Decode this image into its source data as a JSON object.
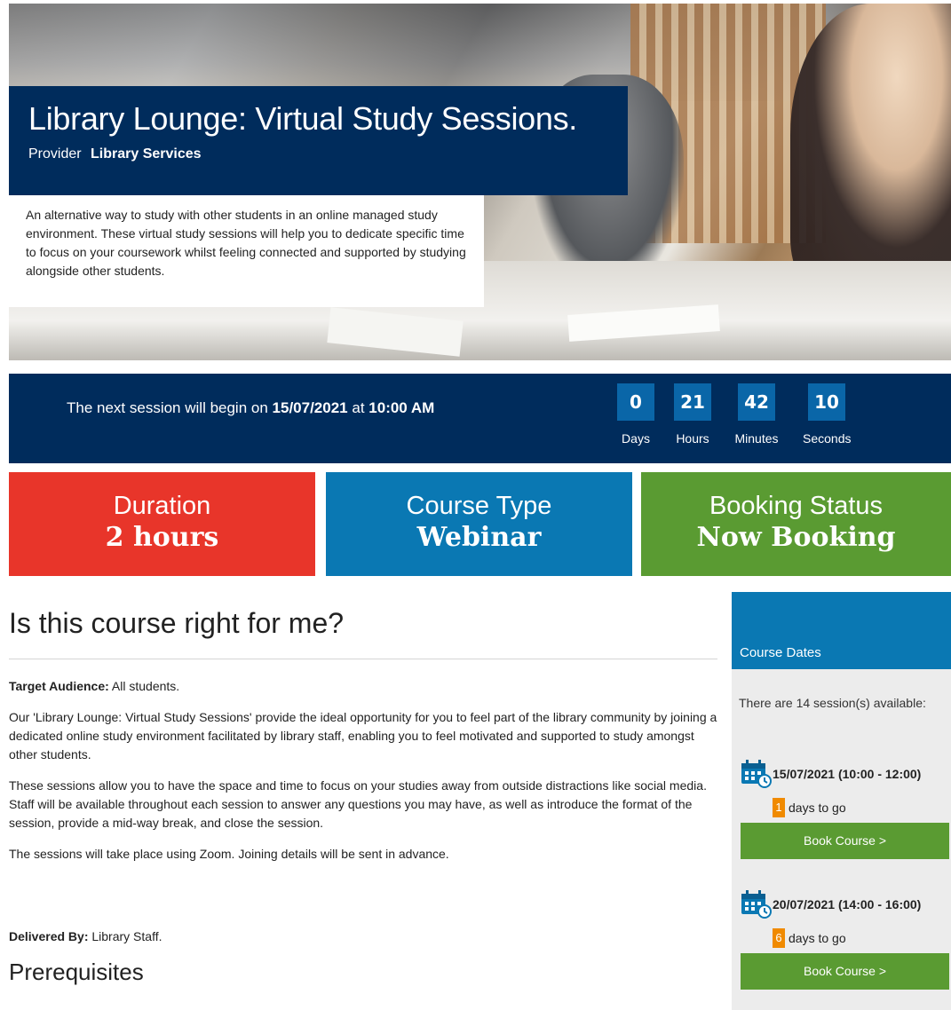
{
  "hero": {
    "title": "Library Lounge: Virtual Study Sessions.",
    "provider_label": "Provider",
    "provider_name": "Library Services",
    "description": "An alternative way to study with other students in an online managed study environment. These virtual study sessions will help you to dedicate specific time to focus on your coursework whilst feeling connected and supported by studying alongside other students."
  },
  "countdown": {
    "prefix": "The next session will begin on",
    "date": "15/07/2021",
    "at": "at",
    "time": "10:00 AM",
    "units": [
      {
        "value": "0",
        "label": "Days"
      },
      {
        "value": "21",
        "label": "Hours"
      },
      {
        "value": "42",
        "label": "Minutes"
      },
      {
        "value": "10",
        "label": "Seconds"
      }
    ]
  },
  "stats": {
    "duration": {
      "label": "Duration",
      "value": "2 hours",
      "color": "#e8352a"
    },
    "course_type": {
      "label": "Course Type",
      "value": "Webinar",
      "color": "#0a78b3"
    },
    "booking_status": {
      "label": "Booking Status",
      "value": "Now Booking",
      "color": "#5a9b32"
    }
  },
  "main": {
    "heading": "Is this course right for me?",
    "target_label": "Target Audience:",
    "target_value": "All students.",
    "para1": "Our 'Library Lounge: Virtual Study Sessions' provide the ideal opportunity for you to feel part of the library community by joining a dedicated online study environment facilitated by library staff, enabling you to feel motivated and supported to study amongst other students.",
    "para2": "These sessions allow you to have the space and time to focus on your studies away from outside distractions like social media. Staff will be available throughout each session to answer any questions you may have, as well as introduce the format of the session, provide a mid-way break, and close the session.",
    "para3": "The sessions will take place using Zoom. Joining details will be sent in advance.",
    "delivered_label": "Delivered By:",
    "delivered_value": "Library Staff.",
    "prereq_heading": "Prerequisites"
  },
  "sidebar": {
    "title": "Course Dates",
    "count_text": "There are 14 session(s) available:",
    "sessions": [
      {
        "date": "15/07/2021 (10:00 - 12:00)",
        "days": "1",
        "days_suffix": "days to go",
        "button": "Book Course   >"
      },
      {
        "date": "20/07/2021 (14:00 - 16:00)",
        "days": "6",
        "days_suffix": "days to go",
        "button": "Book Course   >"
      }
    ]
  }
}
